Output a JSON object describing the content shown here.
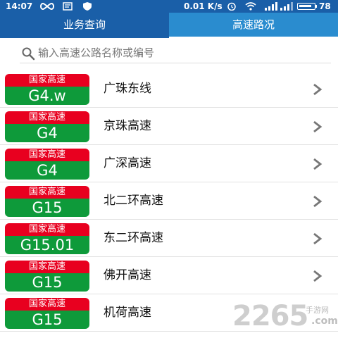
{
  "status_bar": {
    "time": "14:07",
    "net_speed": "0.01 K/s",
    "battery": "78"
  },
  "tabs": [
    {
      "label": "业务查询",
      "active": false
    },
    {
      "label": "高速路况",
      "active": true
    }
  ],
  "search": {
    "placeholder": "输入高速公路名称或编号",
    "value": ""
  },
  "sign_header": "国家高速",
  "roads": [
    {
      "code": "G4.w",
      "name": "广珠东线"
    },
    {
      "code": "G4",
      "name": "京珠高速"
    },
    {
      "code": "G4",
      "name": "广深高速"
    },
    {
      "code": "G15",
      "name": "北二环高速"
    },
    {
      "code": "G15.01",
      "name": "东二环高速"
    },
    {
      "code": "G15",
      "name": "佛开高速"
    },
    {
      "code": "G15",
      "name": "机荷高速"
    }
  ],
  "colors": {
    "header": "#1a5fa8",
    "active_tab": "#2a8ccf",
    "sign_red": "#e8001f",
    "sign_green": "#0e9a3a"
  },
  "watermark": {
    "number": "2265",
    "site_cn": "手游网",
    "domain": ".com"
  }
}
